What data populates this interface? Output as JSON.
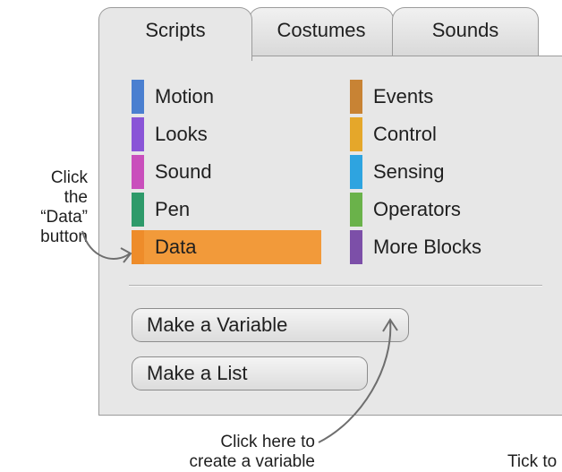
{
  "tabs": [
    {
      "label": "Scripts",
      "active": true
    },
    {
      "label": "Costumes",
      "active": false
    },
    {
      "label": "Sounds",
      "active": false
    }
  ],
  "categories_left": [
    {
      "label": "Motion",
      "color": "#4a7fd0"
    },
    {
      "label": "Looks",
      "color": "#8a55d7"
    },
    {
      "label": "Sound",
      "color": "#c94fbc"
    },
    {
      "label": "Pen",
      "color": "#2e9a6a"
    },
    {
      "label": "Data",
      "color": "#ee8c2a",
      "selected": true
    }
  ],
  "categories_right": [
    {
      "label": "Events",
      "color": "#c88334"
    },
    {
      "label": "Control",
      "color": "#e5a72a"
    },
    {
      "label": "Sensing",
      "color": "#2ea4e0"
    },
    {
      "label": "Operators",
      "color": "#6ab24a"
    },
    {
      "label": "More Blocks",
      "color": "#7c4fa8"
    }
  ],
  "buttons": {
    "make_variable": "Make a Variable",
    "make_list": "Make a List"
  },
  "annotations": {
    "data_line1": "Click the",
    "data_line2": "“Data”",
    "data_line3": "button",
    "var_line1": "Click here to",
    "var_line2": "create a variable",
    "cutoff": "Tick to"
  },
  "colors": {
    "selected_bg": "#f29a3a",
    "panel_bg": "#e7e7e7"
  }
}
